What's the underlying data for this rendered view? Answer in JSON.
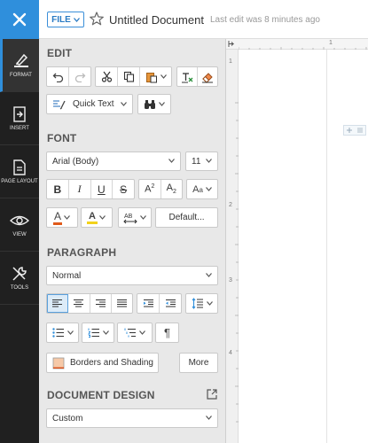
{
  "topbar": {
    "file_label": "FILE",
    "doc_title": "Untitled Document",
    "last_edit": "Last edit was 8 minutes ago"
  },
  "rail": {
    "items": [
      {
        "label": "FORMAT",
        "icon": "format-icon"
      },
      {
        "label": "INSERT",
        "icon": "insert-icon"
      },
      {
        "label": "PAGE LAYOUT",
        "icon": "page-layout-icon"
      },
      {
        "label": "VIEW",
        "icon": "eye-icon"
      },
      {
        "label": "TOOLS",
        "icon": "tools-icon"
      }
    ],
    "active": "FORMAT"
  },
  "edit": {
    "title": "EDIT",
    "quick_text": "Quick Text"
  },
  "font": {
    "title": "FONT",
    "family": "Arial (Body)",
    "size": "11",
    "default_label": "Default..."
  },
  "paragraph": {
    "title": "PARAGRAPH",
    "style": "Normal",
    "borders_label": "Borders and Shading",
    "more_label": "More"
  },
  "document_design": {
    "title": "DOCUMENT DESIGN",
    "style": "Custom"
  },
  "ruler": {
    "top_marks": [
      "1"
    ],
    "left_marks": [
      "1",
      "2",
      "3",
      "4"
    ]
  },
  "colors": {
    "accent": "#2f8fdc",
    "rail_bg": "#202020",
    "panel_bg": "#e8e8e8",
    "font_color_underline": "#e05a1a",
    "highlight_underline": "#f2d21b"
  }
}
